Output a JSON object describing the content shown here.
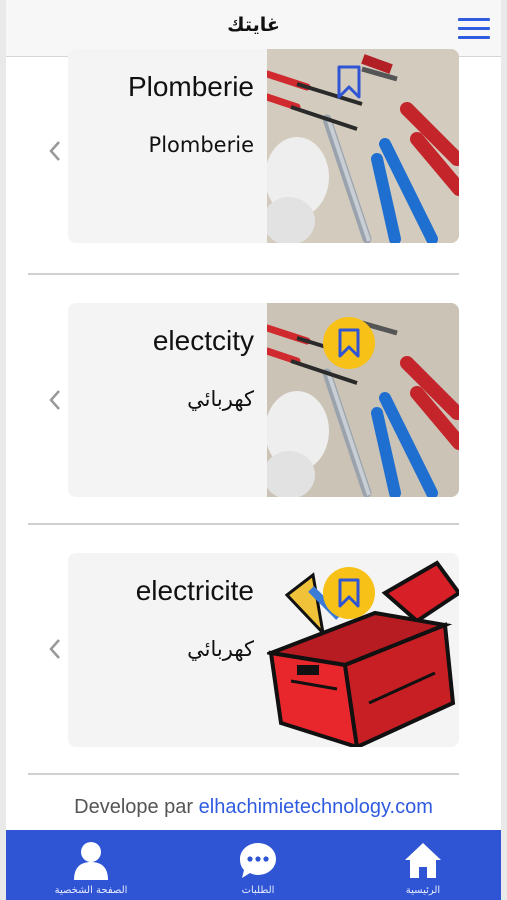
{
  "header": {
    "title": "غايتك",
    "menu_icon": "hamburger-menu-icon"
  },
  "cards": [
    {
      "name": "Plomberie",
      "subtitle": "Plomberie",
      "image": "tools-photo",
      "bookmark_style": "outline"
    },
    {
      "name": "electcity",
      "subtitle": "كهربائي",
      "image": "tools-photo",
      "bookmark_style": "filled-circle"
    },
    {
      "name": "electricite",
      "subtitle": "كهربائي",
      "image": "red-toolbox-illustration",
      "bookmark_style": "filled-circle"
    }
  ],
  "footer": {
    "prefix": "Develope par",
    "link": "elhachimietechnology.com"
  },
  "bottom_nav": [
    {
      "label": "الصفحة الشخصية",
      "icon": "person-icon"
    },
    {
      "label": "الطلبات",
      "icon": "chat-bubble-icon"
    },
    {
      "label": "الرئيسية",
      "icon": "home-icon"
    }
  ],
  "colors": {
    "accent": "#2f55d4",
    "bookmark": "#f7c118",
    "card_bg": "#f4f4f4"
  }
}
